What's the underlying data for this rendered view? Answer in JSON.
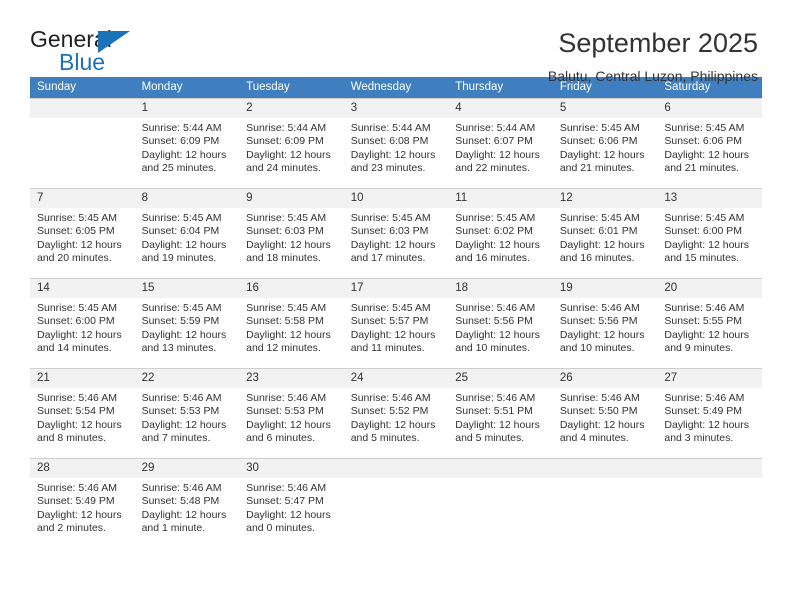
{
  "brand": {
    "name_top": "General",
    "name_bottom": "Blue",
    "logo_icon": "triangle-logo-icon",
    "accent_color": "#1b72b8"
  },
  "header": {
    "month_title": "September 2025",
    "location": "Balutu, Central Luzon, Philippines"
  },
  "calendar": {
    "header_background": "#3f7fbf",
    "daynum_background": "#f2f2f2",
    "weekday_headers": [
      "Sunday",
      "Monday",
      "Tuesday",
      "Wednesday",
      "Thursday",
      "Friday",
      "Saturday"
    ],
    "weeks": [
      [
        {
          "day": "",
          "lines": []
        },
        {
          "day": "1",
          "lines": [
            "Sunrise: 5:44 AM",
            "Sunset: 6:09 PM",
            "Daylight: 12 hours",
            "and 25 minutes."
          ]
        },
        {
          "day": "2",
          "lines": [
            "Sunrise: 5:44 AM",
            "Sunset: 6:09 PM",
            "Daylight: 12 hours",
            "and 24 minutes."
          ]
        },
        {
          "day": "3",
          "lines": [
            "Sunrise: 5:44 AM",
            "Sunset: 6:08 PM",
            "Daylight: 12 hours",
            "and 23 minutes."
          ]
        },
        {
          "day": "4",
          "lines": [
            "Sunrise: 5:44 AM",
            "Sunset: 6:07 PM",
            "Daylight: 12 hours",
            "and 22 minutes."
          ]
        },
        {
          "day": "5",
          "lines": [
            "Sunrise: 5:45 AM",
            "Sunset: 6:06 PM",
            "Daylight: 12 hours",
            "and 21 minutes."
          ]
        },
        {
          "day": "6",
          "lines": [
            "Sunrise: 5:45 AM",
            "Sunset: 6:06 PM",
            "Daylight: 12 hours",
            "and 21 minutes."
          ]
        }
      ],
      [
        {
          "day": "7",
          "lines": [
            "Sunrise: 5:45 AM",
            "Sunset: 6:05 PM",
            "Daylight: 12 hours",
            "and 20 minutes."
          ]
        },
        {
          "day": "8",
          "lines": [
            "Sunrise: 5:45 AM",
            "Sunset: 6:04 PM",
            "Daylight: 12 hours",
            "and 19 minutes."
          ]
        },
        {
          "day": "9",
          "lines": [
            "Sunrise: 5:45 AM",
            "Sunset: 6:03 PM",
            "Daylight: 12 hours",
            "and 18 minutes."
          ]
        },
        {
          "day": "10",
          "lines": [
            "Sunrise: 5:45 AM",
            "Sunset: 6:03 PM",
            "Daylight: 12 hours",
            "and 17 minutes."
          ]
        },
        {
          "day": "11",
          "lines": [
            "Sunrise: 5:45 AM",
            "Sunset: 6:02 PM",
            "Daylight: 12 hours",
            "and 16 minutes."
          ]
        },
        {
          "day": "12",
          "lines": [
            "Sunrise: 5:45 AM",
            "Sunset: 6:01 PM",
            "Daylight: 12 hours",
            "and 16 minutes."
          ]
        },
        {
          "day": "13",
          "lines": [
            "Sunrise: 5:45 AM",
            "Sunset: 6:00 PM",
            "Daylight: 12 hours",
            "and 15 minutes."
          ]
        }
      ],
      [
        {
          "day": "14",
          "lines": [
            "Sunrise: 5:45 AM",
            "Sunset: 6:00 PM",
            "Daylight: 12 hours",
            "and 14 minutes."
          ]
        },
        {
          "day": "15",
          "lines": [
            "Sunrise: 5:45 AM",
            "Sunset: 5:59 PM",
            "Daylight: 12 hours",
            "and 13 minutes."
          ]
        },
        {
          "day": "16",
          "lines": [
            "Sunrise: 5:45 AM",
            "Sunset: 5:58 PM",
            "Daylight: 12 hours",
            "and 12 minutes."
          ]
        },
        {
          "day": "17",
          "lines": [
            "Sunrise: 5:45 AM",
            "Sunset: 5:57 PM",
            "Daylight: 12 hours",
            "and 11 minutes."
          ]
        },
        {
          "day": "18",
          "lines": [
            "Sunrise: 5:46 AM",
            "Sunset: 5:56 PM",
            "Daylight: 12 hours",
            "and 10 minutes."
          ]
        },
        {
          "day": "19",
          "lines": [
            "Sunrise: 5:46 AM",
            "Sunset: 5:56 PM",
            "Daylight: 12 hours",
            "and 10 minutes."
          ]
        },
        {
          "day": "20",
          "lines": [
            "Sunrise: 5:46 AM",
            "Sunset: 5:55 PM",
            "Daylight: 12 hours",
            "and 9 minutes."
          ]
        }
      ],
      [
        {
          "day": "21",
          "lines": [
            "Sunrise: 5:46 AM",
            "Sunset: 5:54 PM",
            "Daylight: 12 hours",
            "and 8 minutes."
          ]
        },
        {
          "day": "22",
          "lines": [
            "Sunrise: 5:46 AM",
            "Sunset: 5:53 PM",
            "Daylight: 12 hours",
            "and 7 minutes."
          ]
        },
        {
          "day": "23",
          "lines": [
            "Sunrise: 5:46 AM",
            "Sunset: 5:53 PM",
            "Daylight: 12 hours",
            "and 6 minutes."
          ]
        },
        {
          "day": "24",
          "lines": [
            "Sunrise: 5:46 AM",
            "Sunset: 5:52 PM",
            "Daylight: 12 hours",
            "and 5 minutes."
          ]
        },
        {
          "day": "25",
          "lines": [
            "Sunrise: 5:46 AM",
            "Sunset: 5:51 PM",
            "Daylight: 12 hours",
            "and 5 minutes."
          ]
        },
        {
          "day": "26",
          "lines": [
            "Sunrise: 5:46 AM",
            "Sunset: 5:50 PM",
            "Daylight: 12 hours",
            "and 4 minutes."
          ]
        },
        {
          "day": "27",
          "lines": [
            "Sunrise: 5:46 AM",
            "Sunset: 5:49 PM",
            "Daylight: 12 hours",
            "and 3 minutes."
          ]
        }
      ],
      [
        {
          "day": "28",
          "lines": [
            "Sunrise: 5:46 AM",
            "Sunset: 5:49 PM",
            "Daylight: 12 hours",
            "and 2 minutes."
          ]
        },
        {
          "day": "29",
          "lines": [
            "Sunrise: 5:46 AM",
            "Sunset: 5:48 PM",
            "Daylight: 12 hours",
            "and 1 minute."
          ]
        },
        {
          "day": "30",
          "lines": [
            "Sunrise: 5:46 AM",
            "Sunset: 5:47 PM",
            "Daylight: 12 hours",
            "and 0 minutes."
          ]
        },
        {
          "day": "",
          "lines": []
        },
        {
          "day": "",
          "lines": []
        },
        {
          "day": "",
          "lines": []
        },
        {
          "day": "",
          "lines": []
        }
      ]
    ]
  }
}
